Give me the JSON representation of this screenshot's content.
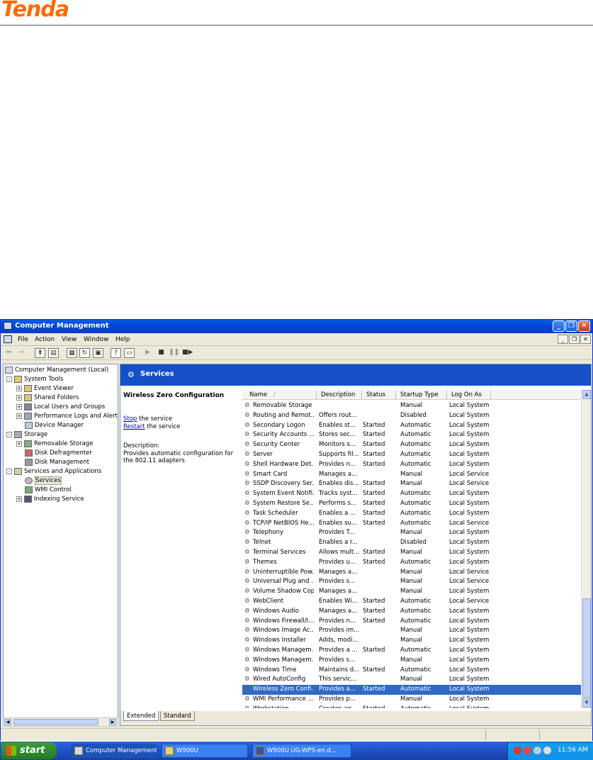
{
  "logo": "Tenda",
  "window": {
    "title": "Computer Management",
    "menu": [
      "File",
      "Action",
      "View",
      "Window",
      "Help"
    ]
  },
  "tree": [
    {
      "label": "Computer Management (Local)",
      "level": 0,
      "expander": ""
    },
    {
      "label": "System Tools",
      "level": 1,
      "expander": "-"
    },
    {
      "label": "Event Viewer",
      "level": 2,
      "expander": "+"
    },
    {
      "label": "Shared Folders",
      "level": 2,
      "expander": "+"
    },
    {
      "label": "Local Users and Groups",
      "level": 2,
      "expander": "+"
    },
    {
      "label": "Performance Logs and Alert",
      "level": 2,
      "expander": "+"
    },
    {
      "label": "Device Manager",
      "level": 2,
      "expander": ""
    },
    {
      "label": "Storage",
      "level": 1,
      "expander": "-"
    },
    {
      "label": "Removable Storage",
      "level": 2,
      "expander": "+"
    },
    {
      "label": "Disk Defragmenter",
      "level": 2,
      "expander": ""
    },
    {
      "label": "Disk Management",
      "level": 2,
      "expander": ""
    },
    {
      "label": "Services and Applications",
      "level": 1,
      "expander": "-"
    },
    {
      "label": "Services",
      "level": 2,
      "expander": "",
      "selected": true
    },
    {
      "label": "WMI Control",
      "level": 2,
      "expander": ""
    },
    {
      "label": "Indexing Service",
      "level": 2,
      "expander": "+"
    }
  ],
  "panel": {
    "header": "Services",
    "selected_title": "Wireless Zero Configuration",
    "stop_link": "Stop",
    "stop_rest": " the service",
    "restart_link": "Restart",
    "restart_rest": " the service",
    "description_label": "Description:",
    "description_text": "Provides automatic configuration for the 802.11 adapters"
  },
  "columns": [
    "Name",
    "Description",
    "Status",
    "Startup Type",
    "Log On As"
  ],
  "services": [
    [
      "Removable Storage",
      "",
      "",
      "Manual",
      "Local System"
    ],
    [
      "Routing and Remot...",
      "Offers rout...",
      "",
      "Disabled",
      "Local System"
    ],
    [
      "Secondary Logon",
      "Enables st...",
      "Started",
      "Automatic",
      "Local System"
    ],
    [
      "Security Accounts ...",
      "Stores sec...",
      "Started",
      "Automatic",
      "Local System"
    ],
    [
      "Security Center",
      "Monitors s...",
      "Started",
      "Automatic",
      "Local System"
    ],
    [
      "Server",
      "Supports fil...",
      "Started",
      "Automatic",
      "Local System"
    ],
    [
      "Shell Hardware Det...",
      "Provides n...",
      "Started",
      "Automatic",
      "Local System"
    ],
    [
      "Smart Card",
      "Manages a...",
      "",
      "Manual",
      "Local Service"
    ],
    [
      "SSDP Discovery Ser...",
      "Enables dis...",
      "Started",
      "Manual",
      "Local Service"
    ],
    [
      "System Event Notifi...",
      "Tracks syst...",
      "Started",
      "Automatic",
      "Local System"
    ],
    [
      "System Restore Se...",
      "Performs s...",
      "Started",
      "Automatic",
      "Local System"
    ],
    [
      "Task Scheduler",
      "Enables a ...",
      "Started",
      "Automatic",
      "Local System"
    ],
    [
      "TCP/IP NetBIOS He...",
      "Enables su...",
      "Started",
      "Automatic",
      "Local Service"
    ],
    [
      "Telephony",
      "Provides T...",
      "",
      "Manual",
      "Local System"
    ],
    [
      "Telnet",
      "Enables a r...",
      "",
      "Disabled",
      "Local System"
    ],
    [
      "Terminal Services",
      "Allows mult...",
      "Started",
      "Manual",
      "Local System"
    ],
    [
      "Themes",
      "Provides u...",
      "Started",
      "Automatic",
      "Local System"
    ],
    [
      "Uninterruptible Pow...",
      "Manages a...",
      "",
      "Manual",
      "Local Service"
    ],
    [
      "Universal Plug and ...",
      "Provides s...",
      "",
      "Manual",
      "Local Service"
    ],
    [
      "Volume Shadow Copy",
      "Manages a...",
      "",
      "Manual",
      "Local System"
    ],
    [
      "WebClient",
      "Enables Wi...",
      "Started",
      "Automatic",
      "Local Service"
    ],
    [
      "Windows Audio",
      "Manages a...",
      "Started",
      "Automatic",
      "Local System"
    ],
    [
      "Windows Firewall/I...",
      "Provides n...",
      "Started",
      "Automatic",
      "Local System"
    ],
    [
      "Windows Image Ac...",
      "Provides im...",
      "",
      "Manual",
      "Local System"
    ],
    [
      "Windows Installer",
      "Adds, modi...",
      "",
      "Manual",
      "Local System"
    ],
    [
      "Windows Managem...",
      "Provides a ...",
      "Started",
      "Automatic",
      "Local System"
    ],
    [
      "Windows Managem...",
      "Provides s...",
      "",
      "Manual",
      "Local System"
    ],
    [
      "Windows Time",
      "Maintains d...",
      "Started",
      "Automatic",
      "Local System"
    ],
    [
      "Wired AutoConfig",
      "This servic...",
      "",
      "Manual",
      "Local System"
    ],
    [
      "Wireless Zero Confi...",
      "Provides a...",
      "Started",
      "Automatic",
      "Local System"
    ],
    [
      "WMI Performance ...",
      "Provides p...",
      "",
      "Manual",
      "Local System"
    ],
    [
      "Workstation",
      "Creates an...",
      "Started",
      "Automatic",
      "Local System"
    ]
  ],
  "selected_service_index": 29,
  "tabs": [
    "Extended",
    "Standard"
  ],
  "taskbar": {
    "start": "start",
    "buttons": [
      "Computer Management",
      "W900U",
      "W900U UG-WPS-en.d..."
    ],
    "clock": "11:56 AM"
  }
}
